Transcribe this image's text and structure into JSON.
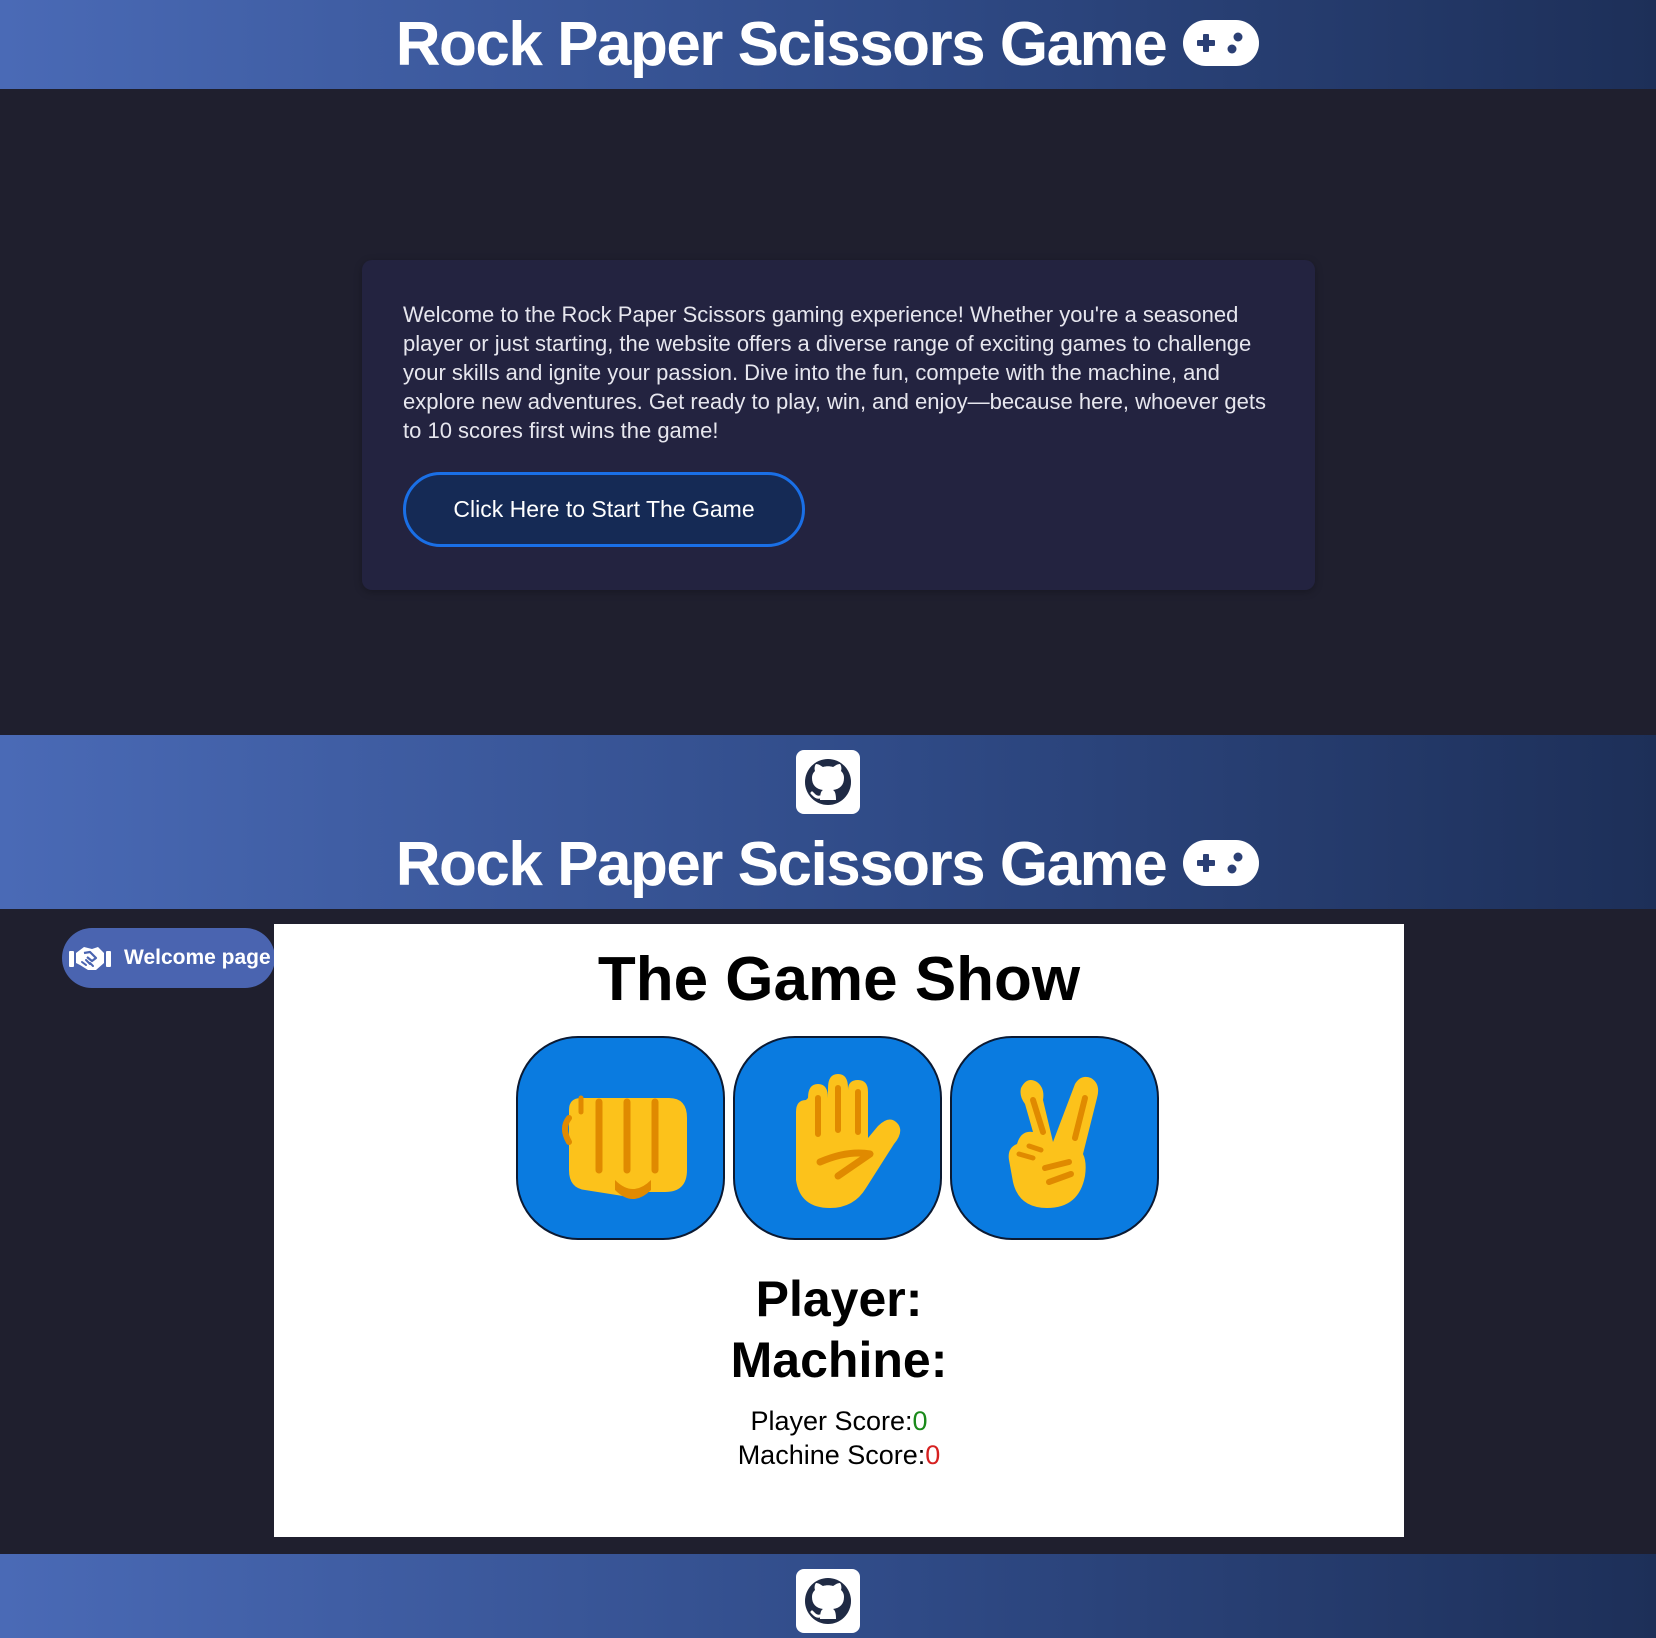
{
  "header": {
    "title": "Rock Paper Scissors Game",
    "icon": "gamepad-icon"
  },
  "welcome": {
    "text": "Welcome to the Rock Paper Scissors gaming experience! Whether you're a seasoned player or just starting, the website offers a diverse range of exciting games to challenge your skills and ignite your passion. Dive into the fun, compete with the machine, and explore new adventures. Get ready to play, win, and enjoy—because here, whoever gets to 10 scores first wins the game!",
    "start_button_label": "Click Here to Start The Game"
  },
  "footer": {
    "icon": "github-icon"
  },
  "nav": {
    "welcome_page_label": "Welcome page",
    "welcome_page_icon": "handshake-icon"
  },
  "game": {
    "title": "The Game Show",
    "choices": [
      {
        "name": "rock",
        "icon": "fist-icon"
      },
      {
        "name": "paper",
        "icon": "raised-hand-icon"
      },
      {
        "name": "scissors",
        "icon": "victory-hand-icon"
      }
    ],
    "player_label": "Player:",
    "machine_label": "Machine:",
    "player_score_label": "Player Score:",
    "player_score_value": "0",
    "machine_score_label": "Machine Score:",
    "machine_score_value": "0"
  },
  "colors": {
    "header_gradient_start": "#4a6ab6",
    "header_gradient_end": "#1d2f58",
    "page_background": "#1f1f2e",
    "card_background": "#232340",
    "button_border": "#1a6fe6",
    "choice_background": "#0a7be0",
    "player_score_color": "#1a8a1a",
    "machine_score_color": "#d62020"
  }
}
